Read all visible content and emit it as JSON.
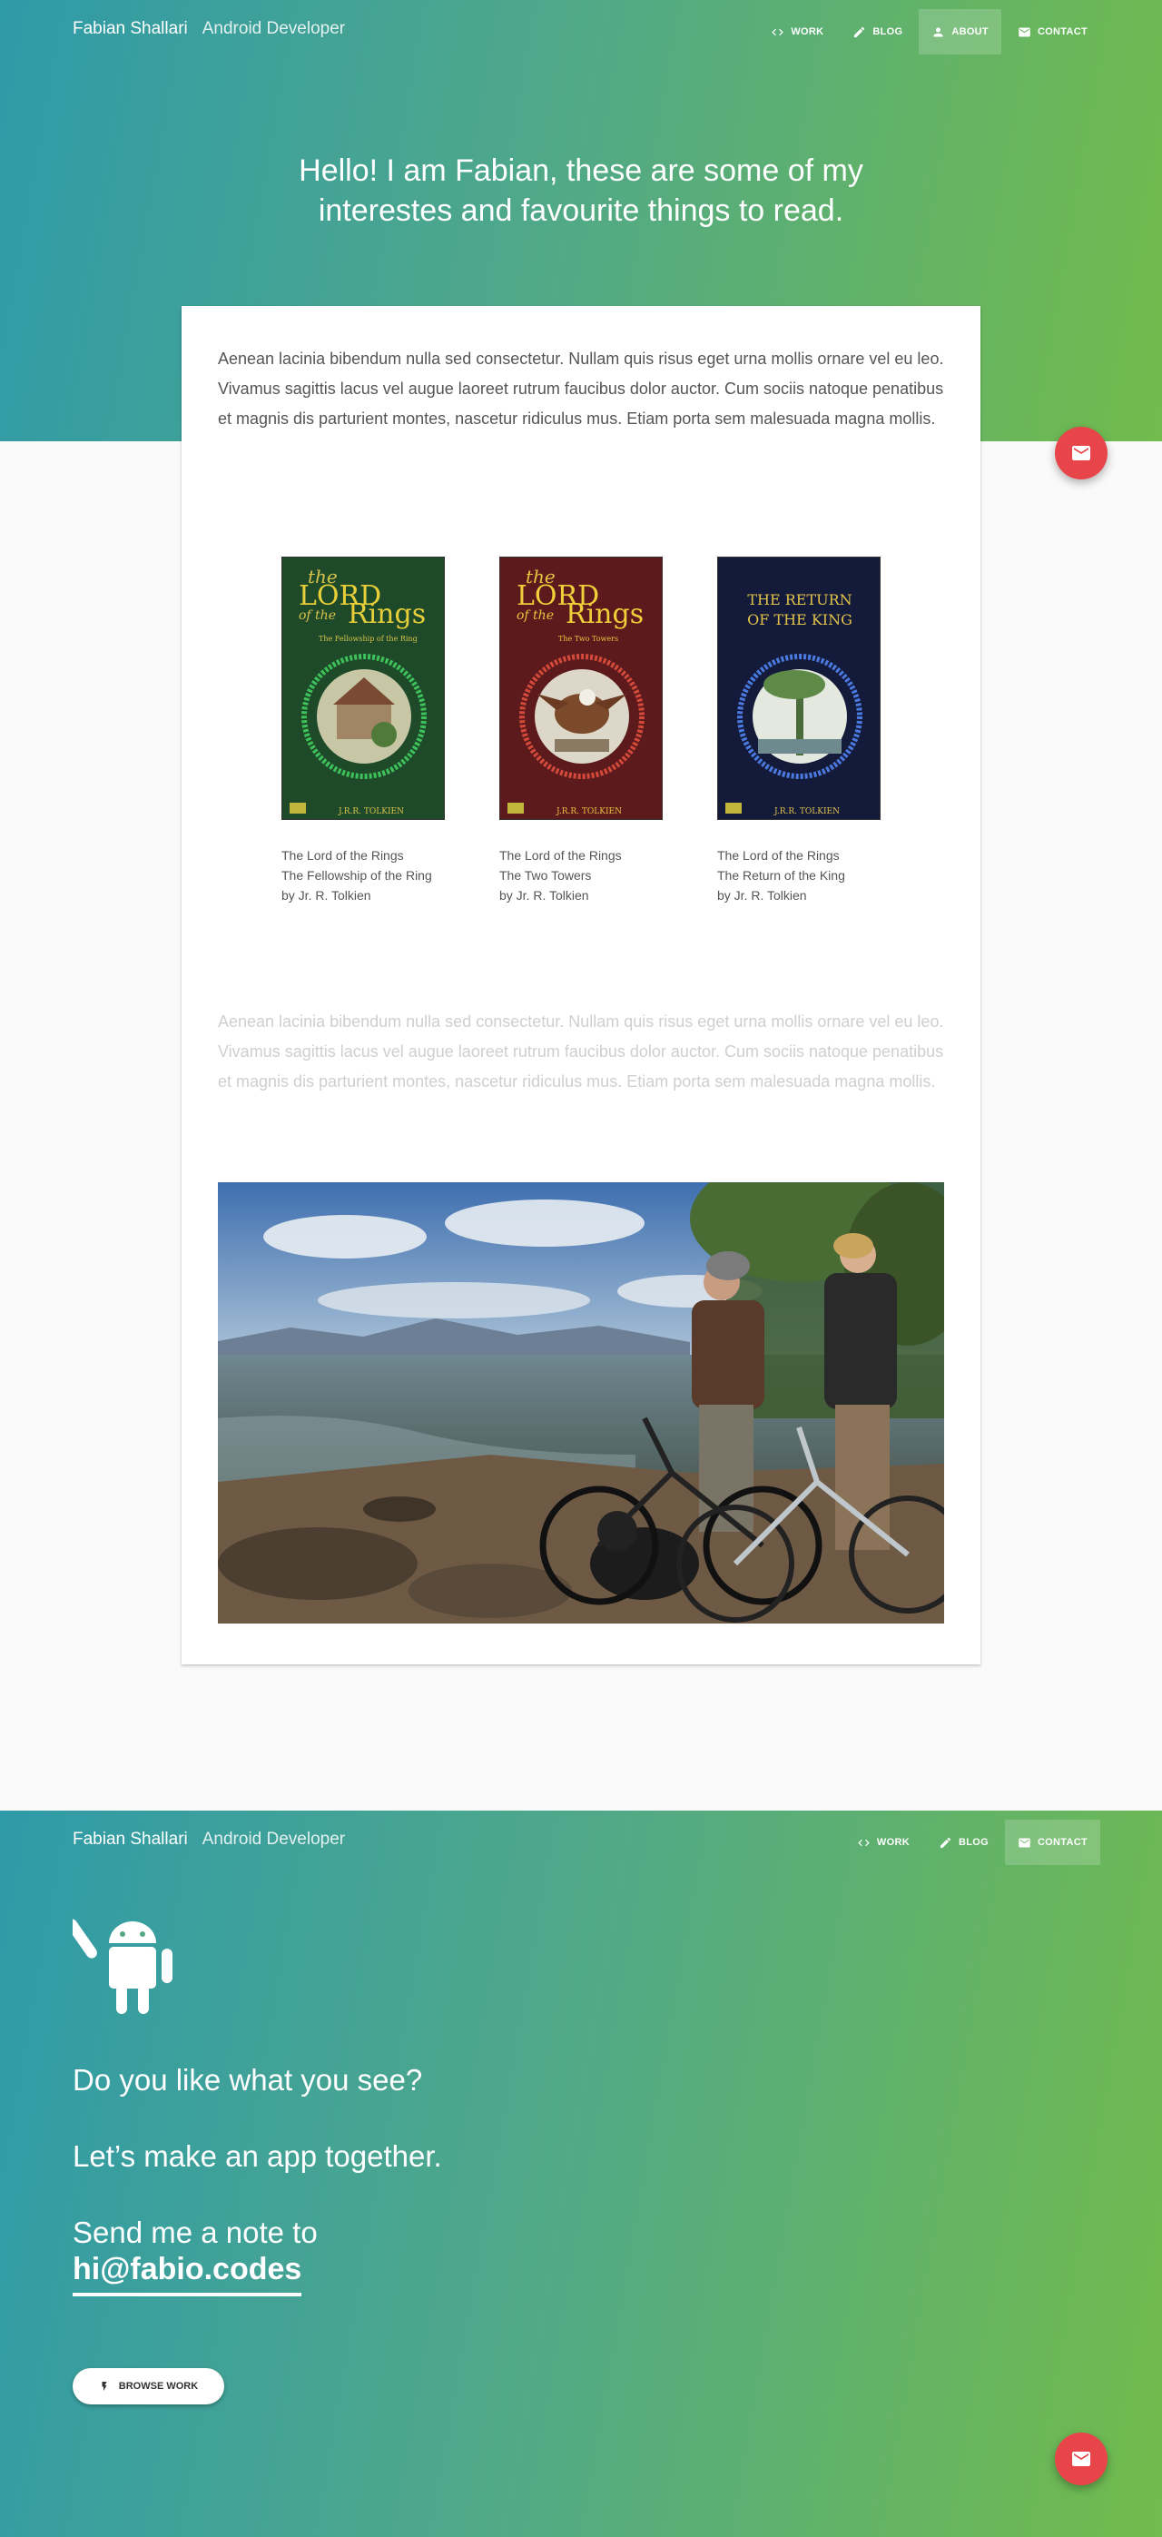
{
  "brand": {
    "name": "Fabian Shallari",
    "role": "Android Developer"
  },
  "nav": {
    "work": "WORK",
    "blog": "BLOG",
    "about": "ABOUT",
    "contact": "CONTACT"
  },
  "hero": {
    "line1": "Hello! I am Fabian, these are some of my",
    "line2": "interestes and favourite things to read."
  },
  "content": {
    "intro": "Aenean lacinia bibendum nulla sed consectetur. Nullam quis risus eget urna mollis ornare vel eu leo. Vivamus sagittis lacus vel augue laoreet rutrum faucibus dolor auctor. Cum sociis natoque penatibus et magnis dis parturient montes, nascetur ridiculus mus. Etiam porta sem malesuada magna mollis.",
    "second": "Aenean lacinia bibendum nulla sed consectetur. Nullam quis risus eget urna mollis ornare vel eu leo. Vivamus sagittis lacus vel augue laoreet rutrum faucibus dolor auctor. Cum sociis natoque penatibus et magnis dis parturient montes, nascetur ridiculus mus. Etiam porta sem malesuada magna mollis."
  },
  "books": [
    {
      "series": "The Lord of the Rings",
      "title": "The Fellowship of the Ring",
      "author": "by Jr. R. Tolkien",
      "cover_color": "#1e4a2a",
      "cover_art": {
        "top_line": "the",
        "main": "LORD",
        "mid": "of the",
        "bottom": "Rings",
        "sub": "The Fellowship of the Ring",
        "foot": "J.R.R. TOLKIEN"
      }
    },
    {
      "series": "The Lord of the Rings",
      "title": "The Two Towers",
      "author": "by Jr. R. Tolkien",
      "cover_color": "#5c1a1c",
      "cover_art": {
        "top_line": "the",
        "main": "LORD",
        "mid": "of the",
        "bottom": "Rings",
        "sub": "The Two Towers",
        "foot": "J.R.R. TOLKIEN"
      }
    },
    {
      "series": "The Lord of the Rings",
      "title": "The Return of the King",
      "author": "by Jr. R. Tolkien",
      "cover_color": "#141a3a",
      "cover_art": {
        "main": "THE RETURN",
        "mid": "OF THE KING",
        "foot": "J.R.R. TOLKIEN"
      }
    }
  ],
  "footer": {
    "line1": "Do you like what you see?",
    "line2": "Let’s make an app together.",
    "line3": "Send me a note to",
    "email": "hi@fabio.codes",
    "browse": "BROWSE WORK"
  },
  "icons": {
    "work": "code-icon",
    "blog": "pencil-icon",
    "about": "person-icon",
    "contact": "mail-icon",
    "fab": "mail-icon",
    "browse": "bolt-icon",
    "android": "android-icon"
  },
  "colors": {
    "gradient_start": "#2f9aa8",
    "gradient_end": "#72bb4c",
    "fab": "#e8454b"
  }
}
